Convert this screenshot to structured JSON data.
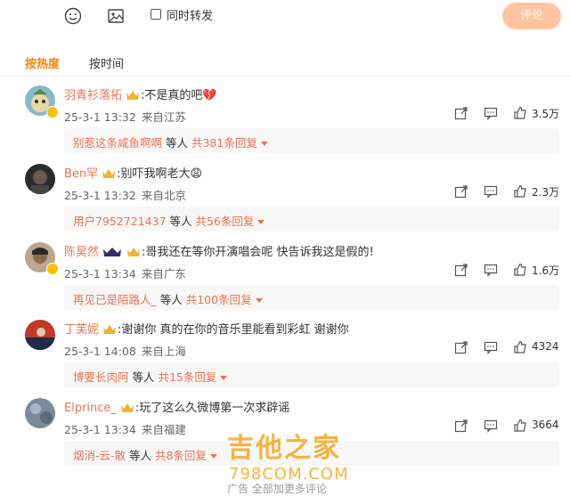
{
  "toolbar": {
    "repost_label": "同时转发",
    "comment_button": "评论",
    "colors": {
      "button_bg": "#ffc49f",
      "accent": "#ff8200",
      "username": "#eb7350"
    },
    "icons": [
      "emoji-icon",
      "image-icon"
    ]
  },
  "tabs": [
    {
      "label": "按热度",
      "active": true
    },
    {
      "label": "按时间",
      "active": false
    }
  ],
  "comments": [
    {
      "username": "羽青衫落拓",
      "text": ":不是真的吧💔",
      "date": "25-3-1 13:32",
      "location": "来自江苏",
      "likes": "3.5万",
      "reply": {
        "name": "别惹这条咸鱼啊啊",
        "middle": " 等人 ",
        "count": "共381条回复"
      }
    },
    {
      "username": "Ben罕",
      "text": ":别吓我啊老大😩",
      "date": "25-3-1 13:32",
      "location": "来自北京",
      "likes": "2.3万",
      "reply": {
        "name": "用户7952721437",
        "middle": " 等人 ",
        "count": "共56条回复"
      }
    },
    {
      "username": "陈昊然",
      "text": ":哥我还在等你开演唱会呢 快告诉我这是假的!",
      "date": "25-3-1 13:34",
      "location": "来自广东",
      "likes": "1.6万",
      "reply": {
        "name": "再见已是陌路人_",
        "middle": " 等人 ",
        "count": "共100条回复"
      }
    },
    {
      "username": "丁芙妮",
      "text": ":谢谢你 真的在你的音乐里能看到彩虹 谢谢你",
      "date": "25-3-1 14:08",
      "location": "来自上海",
      "likes": "4324",
      "reply": {
        "name": "博要长肉阿",
        "middle": " 等人 ",
        "count": "共15条回复"
      }
    },
    {
      "username": "Elprince_",
      "text": ":玩了这么久微博第一次求辟谣",
      "date": "25-3-1 13:34",
      "location": "来自福建",
      "likes": "3664",
      "reply": {
        "name": "烟消-云-散",
        "middle": " 等人 ",
        "count": "共8条回复"
      }
    }
  ],
  "watermark": {
    "main": "吉他之家",
    "sub": "798COM.COM"
  },
  "truncated_text": "广告 全部加更多评论"
}
